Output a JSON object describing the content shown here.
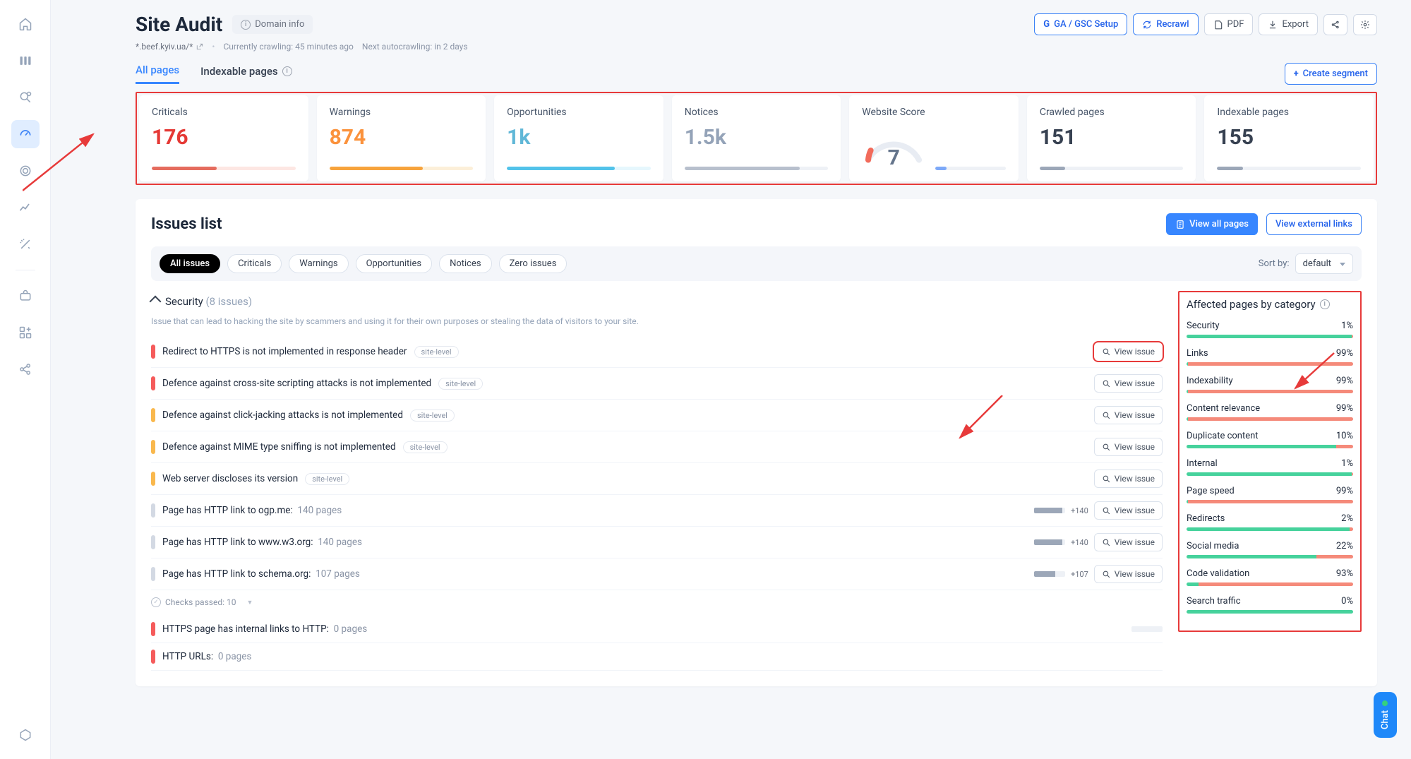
{
  "page": {
    "title": "Site Audit",
    "domain_info_label": "Domain info"
  },
  "header_actions": {
    "ga_gsc": "GA / GSC Setup",
    "recrawl": "Recrawl",
    "pdf": "PDF",
    "export": "Export"
  },
  "meta": {
    "domain": "*.beef.kyiv.ua/*",
    "currently_crawling_label": "Currently crawling:",
    "currently_crawling_value": "45 minutes ago",
    "next_crawl_label": "Next autocrawling:",
    "next_crawl_value": "in 2 days"
  },
  "tabs": {
    "all_pages": "All pages",
    "indexable_pages": "Indexable pages",
    "create_segment": "Create segment"
  },
  "stats": {
    "criticals": {
      "label": "Criticals",
      "value": "176",
      "color": "#e53935",
      "barColor": "#e56c5e",
      "barPct": 45,
      "barBg": "#fde7e3"
    },
    "warnings": {
      "label": "Warnings",
      "value": "874",
      "color": "#fb923c",
      "barColor": "#f7a33c",
      "barPct": 65,
      "barBg": "#fcefd9"
    },
    "opportunities": {
      "label": "Opportunities",
      "value": "1k",
      "color": "#60b7d7",
      "barColor": "#52c3ea",
      "barPct": 75,
      "barBg": "#e6f7fd"
    },
    "notices": {
      "label": "Notices",
      "value": "1.5k",
      "color": "#94a3b8",
      "barColor": "#b8c0cd",
      "barPct": 80,
      "barBg": "#eef1f6"
    },
    "score": {
      "label": "Website Score",
      "value": "7"
    },
    "crawled": {
      "label": "Crawled pages",
      "value": "151",
      "color": "#374151",
      "barColor": "#9ca7b8",
      "barPct": 18,
      "barBg": "#eef1f6"
    },
    "indexable": {
      "label": "Indexable pages",
      "value": "155",
      "color": "#374151",
      "barColor": "#9ca7b8",
      "barPct": 18,
      "barBg": "#eef1f6"
    }
  },
  "issues_panel": {
    "title": "Issues list",
    "view_all_pages": "View all pages",
    "view_external_links": "View external links",
    "pills": [
      "All issues",
      "Criticals",
      "Warnings",
      "Opportunities",
      "Notices",
      "Zero issues"
    ],
    "sort_label": "Sort by:",
    "sort_value": "default"
  },
  "group": {
    "name": "Security",
    "count_label": "(8 issues)",
    "description": "Issue that can lead to hacking the site by scammers and using it for their own purposes or stealing the data of visitors to your site."
  },
  "issue_rows": [
    {
      "sev": "crit",
      "text": "Redirect to HTTPS is not implemented in response header",
      "sitelevel": true,
      "highlight": true
    },
    {
      "sev": "crit",
      "text": "Defence against cross-site scripting attacks is not implemented",
      "sitelevel": true
    },
    {
      "sev": "warn",
      "text": "Defence against click-jacking attacks is not implemented",
      "sitelevel": true
    },
    {
      "sev": "warn",
      "text": "Defence against MIME type sniffing is not implemented",
      "sitelevel": true
    },
    {
      "sev": "warn",
      "text": "Web server discloses its version",
      "sitelevel": true
    },
    {
      "sev": "note",
      "text": "Page has HTTP link to ogp.me:",
      "aux": "140 pages",
      "minibar": 90,
      "badge": "+140"
    },
    {
      "sev": "note",
      "text": "Page has HTTP link to www.w3.org:",
      "aux": "140 pages",
      "minibar": 90,
      "badge": "+140"
    },
    {
      "sev": "note",
      "text": "Page has HTTP link to schema.org:",
      "aux": "107 pages",
      "minibar": 68,
      "badge": "+107"
    }
  ],
  "extra_rows": [
    {
      "sev": "crit",
      "text": "HTTPS page has internal links to HTTP:",
      "aux": "0 pages",
      "minibar": 0
    },
    {
      "sev": "crit",
      "text": "HTTP URLs:",
      "aux": "0 pages"
    }
  ],
  "checks_passed": "Checks passed: 10",
  "view_issue_label": "View issue",
  "sitelevel_label": "site-level",
  "categories_panel": {
    "title": "Affected pages by category",
    "items": [
      {
        "name": "Security",
        "pct": "1%",
        "good": 99,
        "bad": 1
      },
      {
        "name": "Links",
        "pct": "99%",
        "good": 1,
        "bad": 99
      },
      {
        "name": "Indexability",
        "pct": "99%",
        "good": 1,
        "bad": 99
      },
      {
        "name": "Content relevance",
        "pct": "99%",
        "good": 1,
        "bad": 99
      },
      {
        "name": "Duplicate content",
        "pct": "10%",
        "good": 90,
        "bad": 10
      },
      {
        "name": "Internal",
        "pct": "1%",
        "good": 99,
        "bad": 1
      },
      {
        "name": "Page speed",
        "pct": "99%",
        "good": 1,
        "bad": 99
      },
      {
        "name": "Redirects",
        "pct": "2%",
        "good": 98,
        "bad": 2
      },
      {
        "name": "Social media",
        "pct": "22%",
        "good": 78,
        "bad": 22
      },
      {
        "name": "Code validation",
        "pct": "93%",
        "good": 7,
        "bad": 93
      },
      {
        "name": "Search traffic",
        "pct": "0%",
        "good": 100,
        "bad": 0
      }
    ]
  },
  "chat_label": "Chat"
}
